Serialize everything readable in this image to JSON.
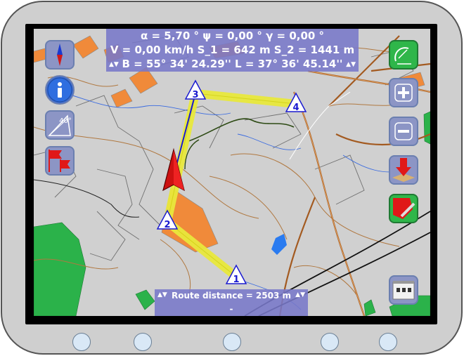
{
  "hud": {
    "line1": "α = 5,70 ° ψ = 0,00 ° γ = 0,00 °",
    "line2": "V = 0,00 km/h S_1 = 642 m S_2 = 1441 m",
    "line3": "B = 55° 34' 24.29''  L = 37° 36' 45.14''"
  },
  "route": {
    "distance": "Route distance = 2503 m",
    "sub": "-"
  },
  "waypoints": [
    {
      "label": "1"
    },
    {
      "label": "2"
    },
    {
      "label": "3"
    },
    {
      "label": "4"
    }
  ],
  "colors": {
    "route": "#e8e83c",
    "heading_arrow": "#cc1111",
    "bearing_line": "#1a1ad0",
    "panel": "#7878c8",
    "forest": "#2bb24a",
    "urban": "#f08a3a"
  },
  "icons": {
    "compass": "compass-icon",
    "info": "info-icon",
    "tilt": "tilt-angle-icon",
    "flags": "waypoint-flags-icon",
    "gps": "satellite-dish-icon",
    "zoom_in": "zoom-in-icon",
    "zoom_out": "zoom-out-icon",
    "download": "download-map-icon",
    "clear_route": "clear-route-icon",
    "building": "building-icon"
  },
  "tilt_label": "40°"
}
